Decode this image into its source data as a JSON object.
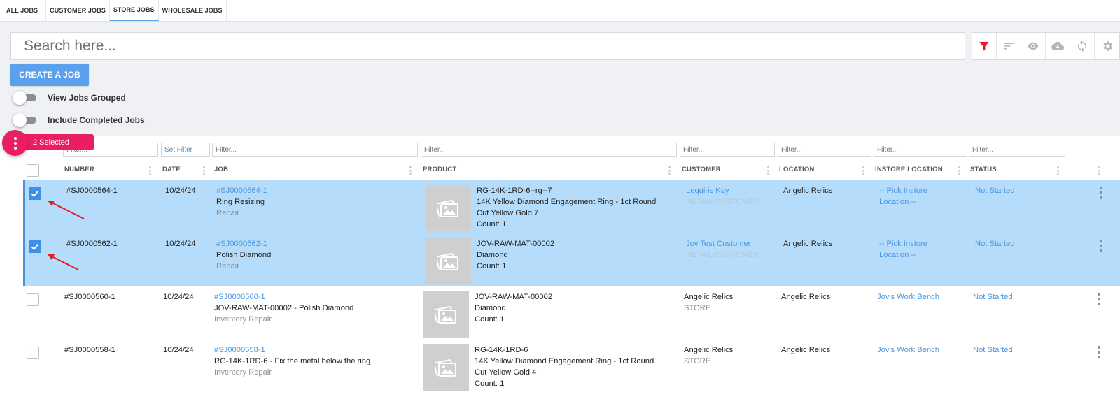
{
  "tabs": [
    {
      "label": "ALL JOBS"
    },
    {
      "label": "CUSTOMER JOBS"
    },
    {
      "label": "STORE JOBS"
    },
    {
      "label": "WHOLESALE JOBS"
    }
  ],
  "active_tab": "STORE JOBS",
  "search": {
    "placeholder": "Search here..."
  },
  "toolbar": [
    "filter-icon",
    "sort-icon",
    "eye-icon",
    "cloud-download-icon",
    "refresh-icon",
    "gear-icon"
  ],
  "create_button": "CREATE A JOB",
  "toggles": {
    "grouped": "View Jobs Grouped",
    "completed": "Include Completed Jobs"
  },
  "selection": {
    "label": "2 Selected"
  },
  "filters": {
    "placeholder": "Filter...",
    "set_filter": "Set Filter"
  },
  "columns": {
    "number": "NUMBER",
    "date": "DATE",
    "job": "JOB",
    "product": "PRODUCT",
    "customer": "CUSTOMER",
    "location": "LOCATION",
    "instore_location": "INSTORE LOCATION",
    "status": "STATUS"
  },
  "rows": [
    {
      "selected": true,
      "number": "#SJ0000564-1",
      "date": "10/24/24",
      "job_link": "#SJ0000564-1",
      "job_title": "Ring Resizing",
      "job_type": "Repair",
      "product_lines": [
        "RG-14K-1RD-6--rg--7",
        "14K Yellow Diamond Engagement Ring - 1ct Round",
        "Cut Yellow Gold 7",
        "Count: 1"
      ],
      "customer_name": "Lequiris Kay",
      "customer_type": "RETAIL CUSTOMER",
      "location": "Angelic Relics",
      "instore_lines": [
        "-- Pick Instore",
        "Location --"
      ],
      "status": "Not Started"
    },
    {
      "selected": true,
      "number": "#SJ0000562-1",
      "date": "10/24/24",
      "job_link": "#SJ0000562-1",
      "job_title": "Polish Diamond",
      "job_type": "Repair",
      "product_lines": [
        "JOV-RAW-MAT-00002",
        "Diamond",
        "Count: 1"
      ],
      "customer_name": "Jov Test Customer",
      "customer_type": "RETAIL CUSTOMER",
      "location": "Angelic Relics",
      "instore_lines": [
        "-- Pick Instore",
        "Location --"
      ],
      "status": "Not Started"
    },
    {
      "selected": false,
      "number": "#SJ0000560-1",
      "date": "10/24/24",
      "job_link": "#SJ0000560-1",
      "job_title": "JOV-RAW-MAT-00002 - Polish Diamond",
      "job_type": "Inventory Repair",
      "product_lines": [
        "JOV-RAW-MAT-00002",
        "Diamond",
        "Count: 1"
      ],
      "customer_name": "Angelic Relics",
      "customer_type": "STORE",
      "location": "Angelic Relics",
      "instore_lines": [
        "Jov's Work Bench"
      ],
      "status": "Not Started"
    },
    {
      "selected": false,
      "number": "#SJ0000558-1",
      "date": "10/24/24",
      "job_link": "#SJ0000558-1",
      "job_title": "RG-14K-1RD-6 - Fix the metal below the ring",
      "job_type": "Inventory Repair",
      "product_lines": [
        "RG-14K-1RD-6",
        "14K Yellow Diamond Engagement Ring - 1ct Round",
        "Cut Yellow Gold 4",
        "Count: 1"
      ],
      "customer_name": "Angelic Relics",
      "customer_type": "STORE",
      "location": "Angelic Relics",
      "instore_lines": [
        "Jov's Work Bench"
      ],
      "status": "Not Started"
    }
  ],
  "colors": {
    "accent": "#5ba0ec",
    "selection": "#b5dcfb",
    "badge": "#e91e63",
    "filter_active": "#e8192c"
  }
}
